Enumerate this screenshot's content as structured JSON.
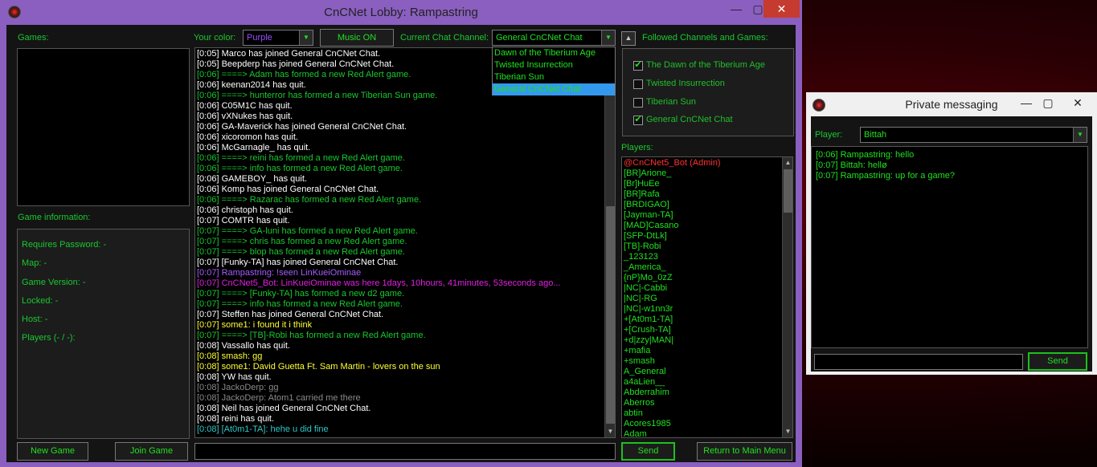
{
  "main_window": {
    "title": "CnCNet Lobby: Rampastring",
    "controls": {
      "minimize": "—",
      "maximize": "▢",
      "close": "✕"
    }
  },
  "labels": {
    "games": "Games:",
    "your_color": "Your color:",
    "current_channel": "Current Chat Channel:",
    "followed": "Followed Channels and Games:",
    "game_info": "Game information:",
    "players": "Players:"
  },
  "color_select": {
    "value": "Purple",
    "value_color": "#9b4dff"
  },
  "music_button": "Music ON",
  "channel_select": {
    "value": "General CnCNet Chat",
    "options": [
      "Dawn of the Tiberium Age",
      "Twisted Insurrection",
      "Tiberian Sun",
      "General CnCNet Chat"
    ],
    "selected_index": 3
  },
  "game_info": [
    "Requires Password: -",
    "Map: -",
    "Game Version: -",
    "Locked: -",
    "Host: -",
    "Players (- / -):"
  ],
  "followed_channels": [
    {
      "label": "The Dawn of the Tiberium Age",
      "checked": true
    },
    {
      "label": "Twisted Insurrection",
      "checked": false
    },
    {
      "label": "Tiberian Sun",
      "checked": false
    },
    {
      "label": "General CnCNet Chat",
      "checked": true
    }
  ],
  "chat": [
    {
      "text": "[0:05] Marco has joined General CnCNet Chat.",
      "color": "#ffffff"
    },
    {
      "text": "[0:05] Beepderp has joined General CnCNet Chat.",
      "color": "#ffffff"
    },
    {
      "text": "[0:06] ====> Adam has formed a new Red Alert game.",
      "color": "#19c92e"
    },
    {
      "text": "[0:06] keenan2014 has quit.",
      "color": "#ffffff"
    },
    {
      "text": "[0:06] ====> hunterror has formed a new Tiberian Sun game.",
      "color": "#19c92e"
    },
    {
      "text": "[0:06] C05M1C has quit.",
      "color": "#ffffff"
    },
    {
      "text": "[0:06] vXNukes has quit.",
      "color": "#ffffff"
    },
    {
      "text": "[0:06] GA-Maverick has joined General CnCNet Chat.",
      "color": "#ffffff"
    },
    {
      "text": "[0:06] xicoromon has quit.",
      "color": "#ffffff"
    },
    {
      "text": "[0:06] McGarnagle_ has quit.",
      "color": "#ffffff"
    },
    {
      "text": "[0:06] ====> reini has formed a new Red Alert game.",
      "color": "#19c92e"
    },
    {
      "text": "[0:06] ====> info has formed a new Red Alert game.",
      "color": "#19c92e"
    },
    {
      "text": "[0:06] GAMEBOY_ has quit.",
      "color": "#ffffff"
    },
    {
      "text": "[0:06] Komp has joined General CnCNet Chat.",
      "color": "#ffffff"
    },
    {
      "text": "[0:06] ====> Razarac has formed a new Red Alert game.",
      "color": "#19c92e"
    },
    {
      "text": "[0:06] christoph has quit.",
      "color": "#ffffff"
    },
    {
      "text": "[0:07] COMTR has quit.",
      "color": "#ffffff"
    },
    {
      "text": "[0:07] ====> GA-luni has formed a new Red Alert game.",
      "color": "#19c92e"
    },
    {
      "text": "[0:07] ====> chris has formed a new Red Alert game.",
      "color": "#19c92e"
    },
    {
      "text": "[0:07] ====> blop has formed a new Red Alert game.",
      "color": "#19c92e"
    },
    {
      "text": "[0:07] [Funky-TA] has joined General CnCNet Chat.",
      "color": "#ffffff"
    },
    {
      "text": "[0:07] Rampastring: !seen LinKueiOminae",
      "color": "#a65cff"
    },
    {
      "text": "[0:07] CnCNet5_Bot: LinKueiOminae was here 1days, 10hours, 41minutes, 53seconds ago...",
      "color": "#e020e0"
    },
    {
      "text": "[0:07] ====> [Funky-TA] has formed a new d2 game.",
      "color": "#19c92e"
    },
    {
      "text": "[0:07] ====> info has formed a new Red Alert game.",
      "color": "#19c92e"
    },
    {
      "text": "[0:07] Steffen has joined General CnCNet Chat.",
      "color": "#ffffff"
    },
    {
      "text": "[0:07] some1: i found it i think",
      "color": "#ffff33"
    },
    {
      "text": "[0:07] ====> [TB]-Robi has formed a new Red Alert game.",
      "color": "#19c92e"
    },
    {
      "text": "[0:08] Vassallo has quit.",
      "color": "#ffffff"
    },
    {
      "text": "[0:08] smash: gg",
      "color": "#ffff33"
    },
    {
      "text": "[0:08] some1: David Guetta Ft. Sam Martin - lovers on the sun",
      "color": "#ffff33"
    },
    {
      "text": "[0:08] YW has quit.",
      "color": "#ffffff"
    },
    {
      "text": "[0:08] JackoDerp: gg",
      "color": "#8a8a8a"
    },
    {
      "text": "[0:08] JackoDerp: Atom1 carried me there",
      "color": "#8a8a8a"
    },
    {
      "text": "[0:08] Neil has joined General CnCNet Chat.",
      "color": "#ffffff"
    },
    {
      "text": "[0:08] reini has quit.",
      "color": "#ffffff"
    },
    {
      "text": "[0:08] [At0m1-TA]: hehe u did fine",
      "color": "#30c8c8"
    }
  ],
  "player_list": [
    {
      "name": "@CnCNet5_Bot (Admin)",
      "color": "#ff3030"
    },
    {
      "name": "[BR]Arione_",
      "color": "#20e020"
    },
    {
      "name": "[Br]HuEe",
      "color": "#20e020"
    },
    {
      "name": "[BR]Rafa",
      "color": "#20e020"
    },
    {
      "name": "[BRDIGAO]",
      "color": "#20e020"
    },
    {
      "name": "[Jayman-TA]",
      "color": "#20e020"
    },
    {
      "name": "[MAD]Casano",
      "color": "#20e020"
    },
    {
      "name": "[SFP-DtLk]",
      "color": "#20e020"
    },
    {
      "name": "[TB]-Robi",
      "color": "#20e020"
    },
    {
      "name": "_123123",
      "color": "#20e020"
    },
    {
      "name": "_America_",
      "color": "#20e020"
    },
    {
      "name": "{nP}Mo_0zZ",
      "color": "#20e020"
    },
    {
      "name": "|NC|-Cabbi",
      "color": "#20e020"
    },
    {
      "name": "|NC|-RG",
      "color": "#20e020"
    },
    {
      "name": "|NC|-w1nn3r",
      "color": "#20e020"
    },
    {
      "name": "+[At0m1-TA]",
      "color": "#20e020"
    },
    {
      "name": "+[Crush-TA]",
      "color": "#20e020"
    },
    {
      "name": "+d|zzy|MAN|",
      "color": "#20e020"
    },
    {
      "name": "+mafia",
      "color": "#20e020"
    },
    {
      "name": "+smash",
      "color": "#20e020"
    },
    {
      "name": "A_General",
      "color": "#20e020"
    },
    {
      "name": "a4aLien__",
      "color": "#20e020"
    },
    {
      "name": "Abderrahim",
      "color": "#20e020"
    },
    {
      "name": "Aberros",
      "color": "#20e020"
    },
    {
      "name": "abtin",
      "color": "#20e020"
    },
    {
      "name": "Acores1985",
      "color": "#20e020"
    },
    {
      "name": "Adam",
      "color": "#20e020"
    }
  ],
  "buttons": {
    "new_game": "New Game",
    "join_game": "Join Game",
    "send": "Send",
    "return_main": "Return to Main Menu"
  },
  "chat_input": {
    "value": ""
  },
  "pm_window": {
    "title": "Private messaging",
    "player_label": "Player:",
    "player_value": "Bittah",
    "messages": [
      "[0:06] Rampastring: hello",
      "[0:07] Bittah: hellø",
      "[0:07] Rampastring: up for a game?"
    ],
    "input_value": "",
    "send": "Send"
  }
}
